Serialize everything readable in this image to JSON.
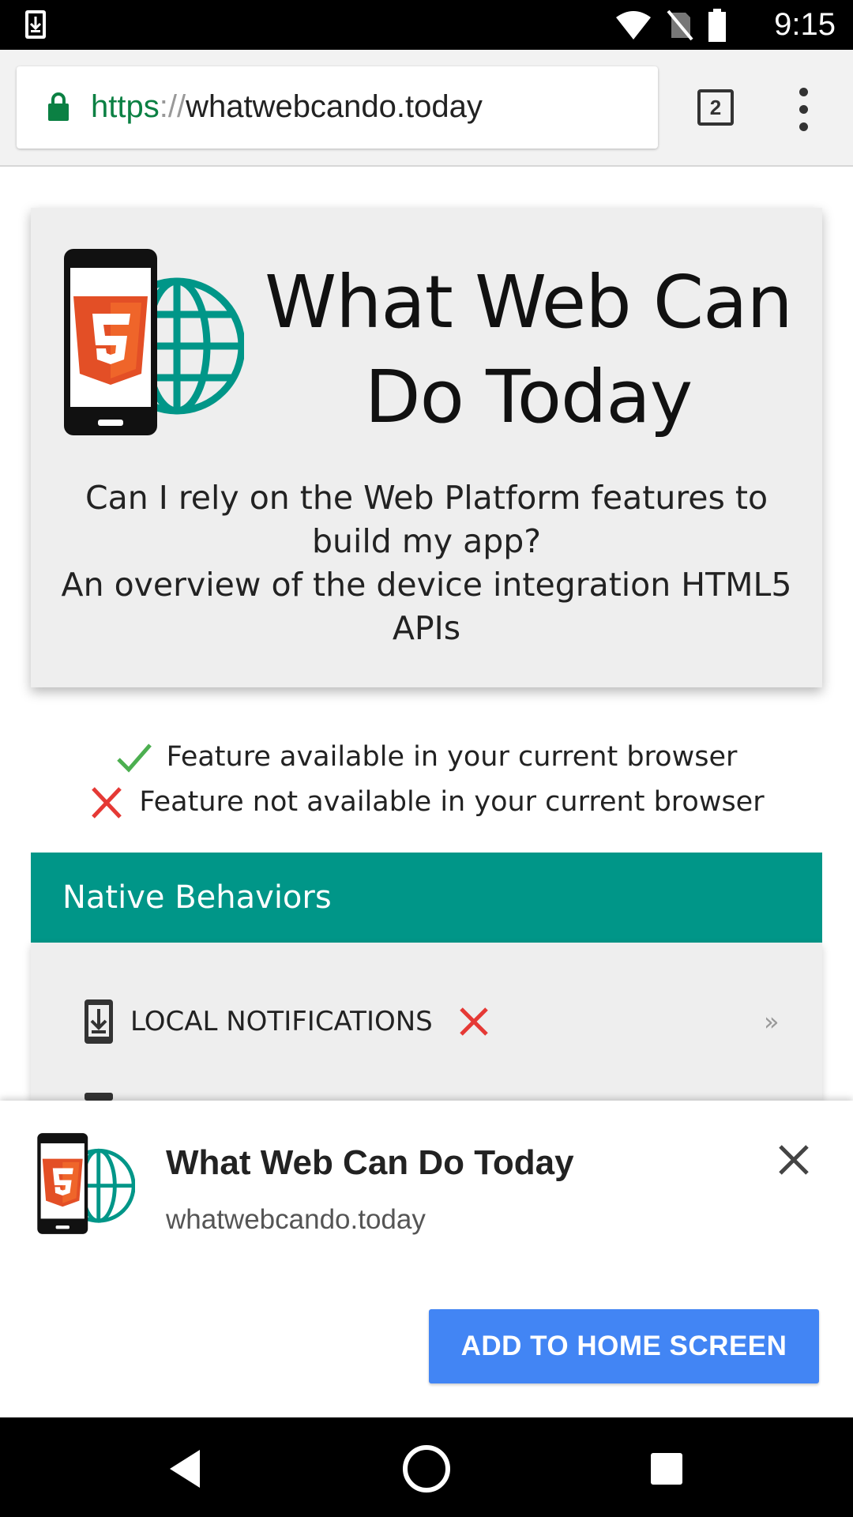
{
  "status_bar": {
    "time": "9:15",
    "icons": [
      "download-icon",
      "wifi-icon",
      "no-sim-icon",
      "battery-icon"
    ]
  },
  "browser": {
    "url_scheme": "https",
    "url_sep": "://",
    "url_host": "whatwebcando.today",
    "tab_count": "2",
    "colors": {
      "secure": "#0b8043"
    }
  },
  "hero": {
    "title_line1": "What Web Can",
    "title_line2": "Do Today",
    "desc_line1": "Can I rely on the Web Platform features to",
    "desc_line2": "build my app?",
    "desc_line3": "An overview of the device integration HTML5",
    "desc_line4": "APIs"
  },
  "legend": {
    "available": "Feature available in your current browser",
    "not_available": "Feature not available in your current browser",
    "colors": {
      "check": "#4caf50",
      "cross": "#e53935"
    }
  },
  "section": {
    "title": "Native Behaviors",
    "color": "#009688",
    "features": [
      {
        "label": "LOCAL NOTIFICATIONS",
        "icon": "notification-download-icon",
        "status": "not-available",
        "more": "»"
      }
    ]
  },
  "a2hs_banner": {
    "app_name": "What Web Can Do Today",
    "app_url": "whatwebcando.today",
    "button_label": "ADD TO HOME SCREEN",
    "button_color": "#4285f4"
  },
  "nav_bar": {
    "buttons": [
      "back-icon",
      "home-icon",
      "recents-icon"
    ]
  }
}
